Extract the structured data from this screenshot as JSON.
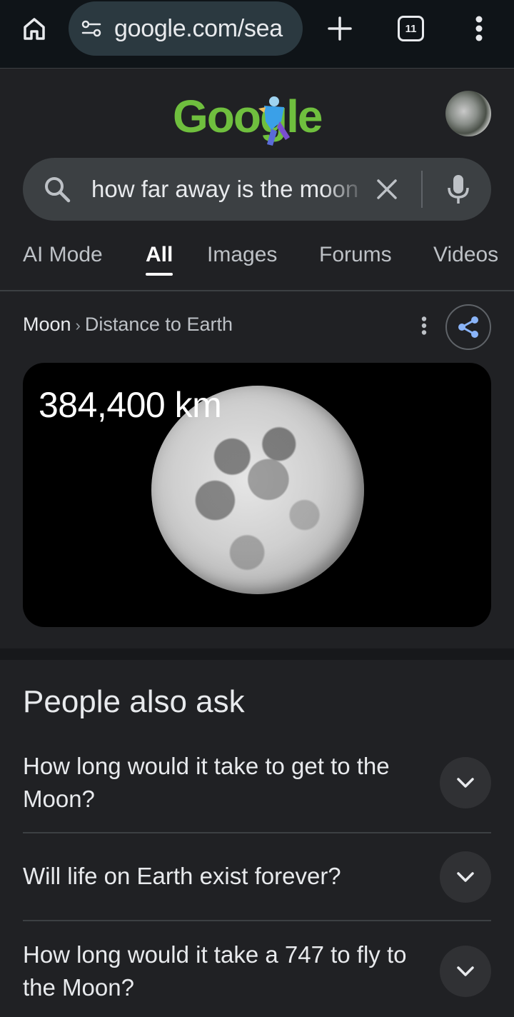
{
  "browser": {
    "url": "google.com/sea",
    "tab_count": "11"
  },
  "logo": {
    "text": "Google"
  },
  "search": {
    "query": "how far away is the moon"
  },
  "tabs": [
    {
      "label": "AI Mode",
      "active": false
    },
    {
      "label": "All",
      "active": true
    },
    {
      "label": "Images",
      "active": false
    },
    {
      "label": "Forums",
      "active": false
    },
    {
      "label": "Videos",
      "active": false
    }
  ],
  "answer": {
    "breadcrumb_entity": "Moon",
    "breadcrumb_separator": "›",
    "breadcrumb_attribute": "Distance to Earth",
    "value": "384,400 km"
  },
  "people_also_ask": {
    "title": "People also ask",
    "questions": [
      "How long would it take to get to the Moon?",
      "Will life on Earth exist forever?",
      "How long would it take a 747 to fly to the Moon?"
    ]
  },
  "colors": {
    "background": "#202124",
    "toolbar": "#0f1418",
    "url_pill": "#2b3940",
    "search_box": "#3c4043",
    "logo_green": "#6fbf3e"
  }
}
